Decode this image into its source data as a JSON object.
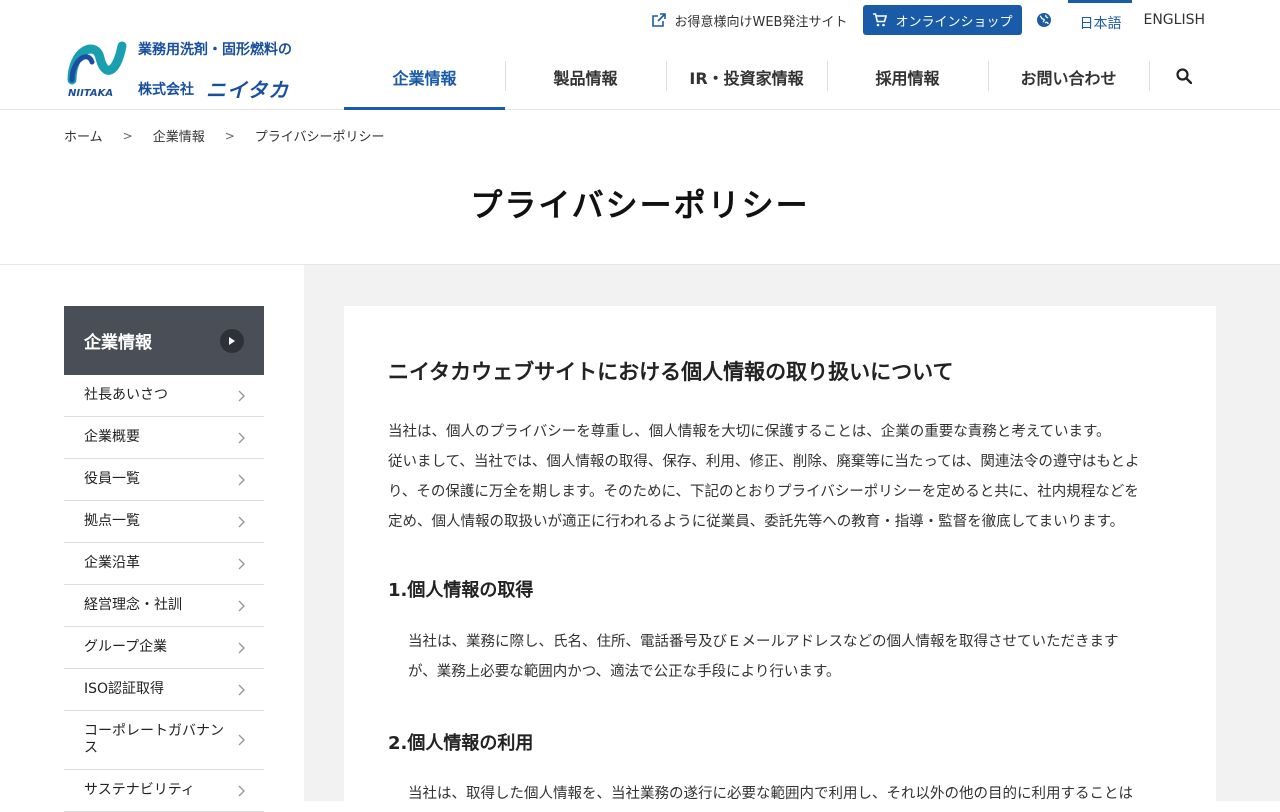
{
  "header": {
    "logo_tagline": "業務用洗剤・固形燃料の",
    "logo_company": "株式会社",
    "logo_brand": "ニイタカ",
    "logo_mark_text": "NIITAKA",
    "util": {
      "web_order_label": "お得意様向けWEB発注サイト",
      "shop_label": "オンラインショップ",
      "lang_ja": "日本語",
      "lang_en": "ENGLISH"
    },
    "nav": [
      {
        "label": "企業情報"
      },
      {
        "label": "製品情報"
      },
      {
        "label": "IR・投資家情報"
      },
      {
        "label": "採用情報"
      },
      {
        "label": "お問い合わせ"
      }
    ]
  },
  "breadcrumb": [
    "ホーム",
    "企業情報",
    "プライバシーポリシー"
  ],
  "page_title": "プライバシーポリシー",
  "sidenav": {
    "title": "企業情報",
    "items": [
      {
        "label": "社長あいさつ"
      },
      {
        "label": "企業概要"
      },
      {
        "label": "役員一覧"
      },
      {
        "label": "拠点一覧"
      },
      {
        "label": "企業沿革"
      },
      {
        "label": "経営理念・社訓"
      },
      {
        "label": "グループ企業"
      },
      {
        "label": "ISO認証取得"
      },
      {
        "label": "コーポレートガバナンス"
      },
      {
        "label": "サステナビリティ"
      }
    ]
  },
  "article": {
    "heading": "ニイタカウェブサイトにおける個人情報の取り扱いについて",
    "intro_lines": [
      "当社は、個人のプライバシーを尊重し、個人情報を大切に保護することは、企業の重要な責務と考えています。",
      "従いまして、当社では、個人情報の取得、保存、利用、修正、削除、廃棄等に当たっては、関連法令の遵守はもとよ",
      "り、その保護に万全を期します。そのために、下記のとおりプライバシーポリシーを定めると共に、社内規程などを",
      "定め、個人情報の取扱いが適正に行われるように従業員、委託先等への教育・指導・監督を徹底してまいります。"
    ],
    "sections": [
      {
        "title": "1.個人情報の取得",
        "lines": [
          "当社は、業務に際し、氏名、住所、電話番号及びＥメールアドレスなどの個人情報を取得させていただきます",
          "が、業務上必要な範囲内かつ、適法で公正な手段により行います。"
        ]
      },
      {
        "title": "2.個人情報の利用",
        "lines": [
          "当社は、取得した個人情報を、当社業務の遂行に必要な範囲内で利用し、それ以外の他の目的に利用することは"
        ]
      }
    ]
  }
}
